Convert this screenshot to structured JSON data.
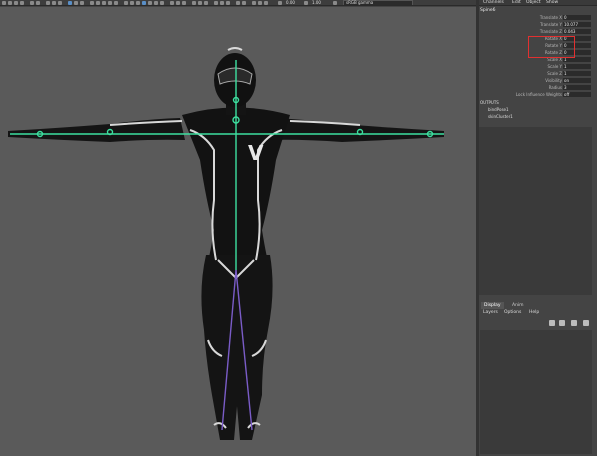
{
  "toolbar": {
    "field_a": "0.00",
    "field_b": "1.00",
    "camera_select": "sRGB gamma"
  },
  "channel_box": {
    "menu": [
      "Channels",
      "Edit",
      "Object",
      "Show"
    ],
    "node_name": "Spine6",
    "attributes": [
      {
        "label": "Translate X",
        "value": "0"
      },
      {
        "label": "Translate Y",
        "value": "10.077"
      },
      {
        "label": "Translate Z",
        "value": "0.043"
      },
      {
        "label": "Rotate X",
        "value": "0"
      },
      {
        "label": "Rotate Y",
        "value": "0"
      },
      {
        "label": "Rotate Z",
        "value": "0"
      },
      {
        "label": "Scale X",
        "value": "1"
      },
      {
        "label": "Scale Y",
        "value": "1"
      },
      {
        "label": "Scale Z",
        "value": "1"
      },
      {
        "label": "Visibility",
        "value": "on"
      },
      {
        "label": "Radius",
        "value": "3"
      },
      {
        "label": "Lock Influence Weights",
        "value": "off"
      }
    ],
    "outputs_header": "OUTPUTS",
    "outputs": [
      "bindPose1",
      "skinCluster1"
    ],
    "highlight_color": "#e23030"
  },
  "layer_editor": {
    "tabs": [
      "Display",
      "Anim"
    ],
    "menu": [
      "Layers",
      "Options",
      "Help"
    ]
  },
  "colors": {
    "viewport_bg": "#5a5a5a",
    "joint_color": "#3de0a0",
    "body_color": "#111111",
    "stripe_color": "#d8d8d8"
  }
}
